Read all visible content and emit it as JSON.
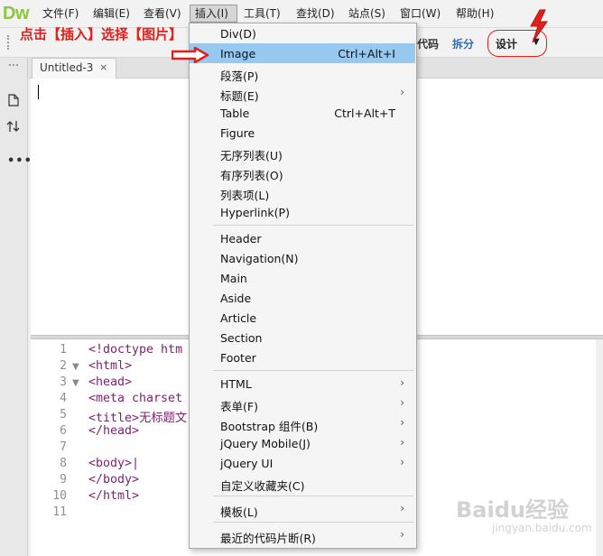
{
  "app": {
    "logo": "Dw"
  },
  "menubar": {
    "items": [
      {
        "label": "文件(F)"
      },
      {
        "label": "编辑(E)"
      },
      {
        "label": "查看(V)"
      },
      {
        "label": "插入(I)"
      },
      {
        "label": "工具(T)"
      },
      {
        "label": "查找(D)"
      },
      {
        "label": "站点(S)"
      },
      {
        "label": "窗口(W)"
      },
      {
        "label": "帮助(H)"
      }
    ]
  },
  "annotation": {
    "instruction": "点击【插入】选择【图片】"
  },
  "toolbar": {
    "code_label": "代码",
    "split_label": "拆分",
    "design_label": "设计",
    "design_arrow": "▼"
  },
  "document": {
    "tab_label": "Untitled-3",
    "close_glyph": "×"
  },
  "code": {
    "lines": [
      {
        "num": "1",
        "fold": "",
        "text": "<!doctype htm"
      },
      {
        "num": "2",
        "fold": "▼",
        "text": "<html>"
      },
      {
        "num": "3",
        "fold": "▼",
        "text": "<head>"
      },
      {
        "num": "4",
        "fold": "",
        "text": "<meta charset"
      },
      {
        "num": "5",
        "fold": "",
        "text": "<title>无标题文"
      },
      {
        "num": "6",
        "fold": "",
        "text": "</head>"
      },
      {
        "num": "7",
        "fold": "",
        "text": ""
      },
      {
        "num": "8",
        "fold": "",
        "text": "<body>|"
      },
      {
        "num": "9",
        "fold": "",
        "text": "</body>"
      },
      {
        "num": "10",
        "fold": "",
        "text": "</html>"
      },
      {
        "num": "11",
        "fold": "",
        "text": ""
      }
    ]
  },
  "insert_menu": {
    "items": [
      {
        "label": "Div(D)",
        "shortcut": "",
        "submenu": false
      },
      {
        "label": "Image",
        "shortcut": "Ctrl+Alt+I",
        "submenu": false,
        "highlighted": true
      },
      {
        "label": "段落(P)",
        "shortcut": "",
        "submenu": false
      },
      {
        "label": "标题(E)",
        "shortcut": "",
        "submenu": true
      },
      {
        "label": "Table",
        "shortcut": "Ctrl+Alt+T",
        "submenu": false
      },
      {
        "label": "Figure",
        "shortcut": "",
        "submenu": false
      },
      {
        "label": "无序列表(U)",
        "shortcut": "",
        "submenu": false
      },
      {
        "label": "有序列表(O)",
        "shortcut": "",
        "submenu": false
      },
      {
        "label": "列表项(L)",
        "shortcut": "",
        "submenu": false
      },
      {
        "label": "Hyperlink(P)",
        "shortcut": "",
        "submenu": false
      },
      {
        "label": "Header",
        "shortcut": "",
        "submenu": false
      },
      {
        "label": "Navigation(N)",
        "shortcut": "",
        "submenu": false
      },
      {
        "label": "Main",
        "shortcut": "",
        "submenu": false
      },
      {
        "label": "Aside",
        "shortcut": "",
        "submenu": false
      },
      {
        "label": "Article",
        "shortcut": "",
        "submenu": false
      },
      {
        "label": "Section",
        "shortcut": "",
        "submenu": false
      },
      {
        "label": "Footer",
        "shortcut": "",
        "submenu": false
      },
      {
        "label": "HTML",
        "shortcut": "",
        "submenu": true
      },
      {
        "label": "表单(F)",
        "shortcut": "",
        "submenu": true
      },
      {
        "label": "Bootstrap 组件(B)",
        "shortcut": "",
        "submenu": true
      },
      {
        "label": "jQuery Mobile(J)",
        "shortcut": "",
        "submenu": true
      },
      {
        "label": "jQuery UI",
        "shortcut": "",
        "submenu": true
      },
      {
        "label": "自定义收藏夹(C)",
        "shortcut": "",
        "submenu": false
      },
      {
        "label": "模板(L)",
        "shortcut": "",
        "submenu": true
      },
      {
        "label": "最近的代码片断(R)",
        "shortcut": "",
        "submenu": true
      }
    ]
  },
  "watermark": {
    "text": "Baidu经验",
    "sub": "jingyan.baidu.com"
  },
  "colors": {
    "annotation": "#e0201b",
    "highlight": "#96c8f0",
    "logo": "#8cc63f"
  }
}
